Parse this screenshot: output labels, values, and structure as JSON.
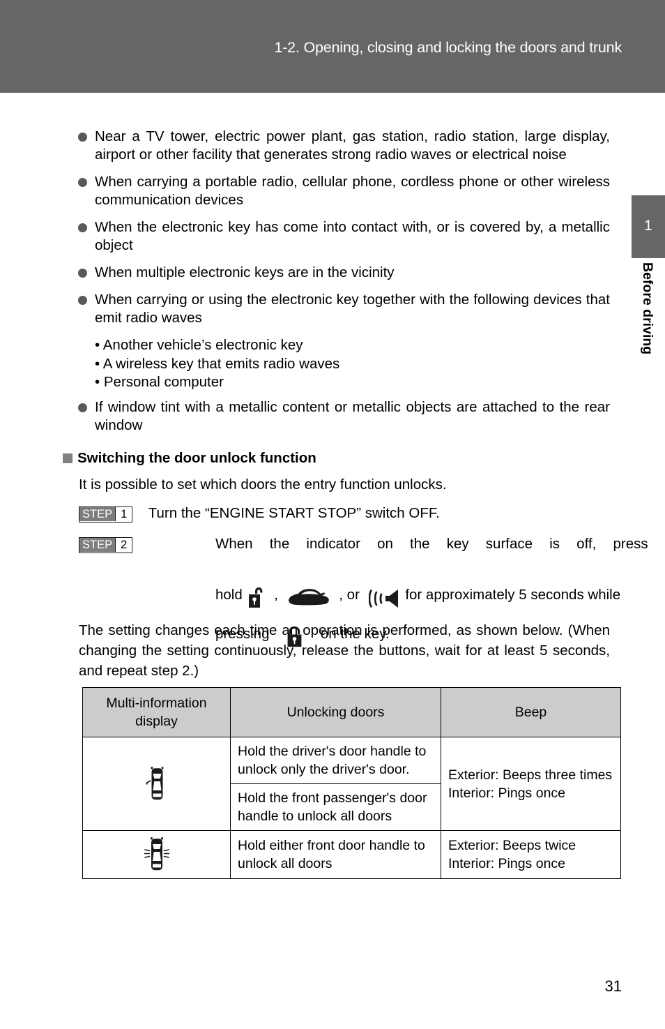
{
  "header": {
    "title": "1-2. Opening, closing and locking the doors and trunk"
  },
  "side_tab": {
    "chapter_number": "1",
    "chapter_label": "Before driving"
  },
  "bullets": [
    {
      "text": "Near a TV tower, electric power plant, gas station, radio station, large display, airport or other facility that generates strong radio waves or electrical noise"
    },
    {
      "text": "When carrying a portable radio, cellular phone, cordless phone or other wireless communication devices"
    },
    {
      "text": "When the electronic key has come into contact with, or is covered by, a metallic object"
    },
    {
      "text": "When multiple electronic keys are in the vicinity"
    },
    {
      "text": "When carrying or using the electronic key together with the following devices that emit radio waves"
    },
    {
      "text": "If window tint with a metallic content or metallic objects are attached to the rear window"
    }
  ],
  "sub_bullets": [
    "• Another vehicle’s electronic key",
    "• A wireless key that emits radio waves",
    "• Personal computer"
  ],
  "section": {
    "heading": "Switching the door unlock function",
    "intro": "It is possible to set which doors the entry function unlocks."
  },
  "steps": [
    {
      "badge_label": "STEP",
      "badge_number": "1",
      "text": "Turn the “ENGINE START STOP” switch OFF."
    },
    {
      "badge_label": "STEP",
      "badge_number": "2",
      "line1": "When the indicator on the key surface is off, press and",
      "line2_a": "hold",
      "line2_sep1": ",",
      "line2_sep2": ",  or",
      "line2_b": "for approximately 5 seconds while",
      "line3_a": "pressing",
      "line3_b": "on the key."
    }
  ],
  "note_paragraph": "The setting changes each time an operation is performed, as shown below. (When changing the setting continuously, release the buttons, wait for at least 5 seconds, and repeat step 2.)",
  "table": {
    "headers": [
      "Multi-information display",
      "Unlocking doors",
      "Beep"
    ],
    "rows": [
      {
        "icon": "car-top-driver-door-icon",
        "unlocking": [
          "Hold the driver's door handle to unlock only the driver's door.",
          "Hold the front passenger's door handle to unlock all doors"
        ],
        "beep": "Exterior: Beeps three times\nInterior: Pings once"
      },
      {
        "icon": "car-top-both-doors-icon",
        "unlocking": [
          "Hold either front door handle to unlock all doors"
        ],
        "beep": "Exterior: Beeps twice\nInterior: Pings once"
      }
    ]
  },
  "footer": {
    "page_number": "31"
  },
  "colors": {
    "header_band": "#666666",
    "table_header": "#cccccc",
    "bullet_dot": "#595959",
    "step_badge": "#7d7d7d"
  }
}
